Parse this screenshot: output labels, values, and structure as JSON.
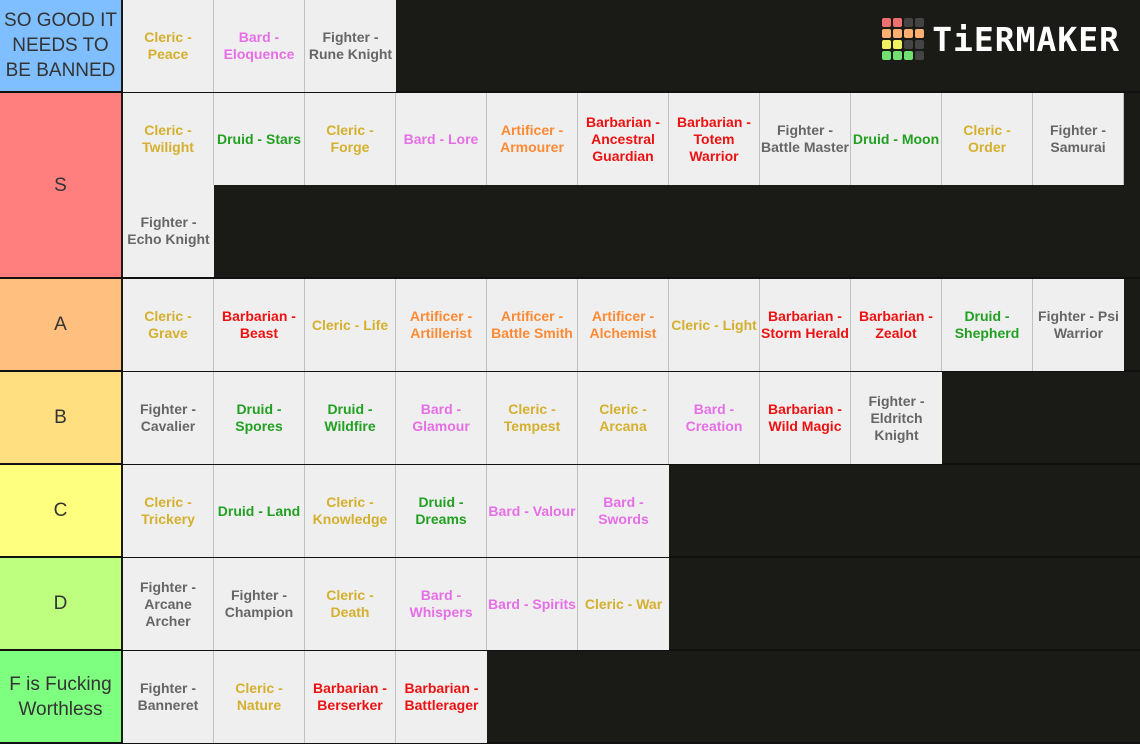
{
  "logo": {
    "text": "TiERMAKER",
    "grid_colors": [
      "#f07070",
      "#f07070",
      "#444444",
      "#444444",
      "#ffb070",
      "#ffb070",
      "#ffb070",
      "#ffb070",
      "#f0f060",
      "#f0f060",
      "#444444",
      "#444444",
      "#70e070",
      "#70e070",
      "#70e070",
      "#444444"
    ]
  },
  "class_colors": {
    "Cleric": "#d4b02e",
    "Bard": "#e66ee6",
    "Fighter": "#666666",
    "Druid": "#22a022",
    "Artificer": "#ff8a33",
    "Barbarian": "#ee1111"
  },
  "tiers": [
    {
      "label": "SO GOOD IT NEEDS TO BE BANNED",
      "color": "#80bfff",
      "items": [
        {
          "text": "Cleric - Peace",
          "cls": "Cleric"
        },
        {
          "text": "Bard - Eloquence",
          "cls": "Bard"
        },
        {
          "text": "Fighter - Rune Knight",
          "cls": "Fighter"
        }
      ]
    },
    {
      "label": "S",
      "color": "#ff7f7f",
      "items": [
        {
          "text": "Cleric - Twilight",
          "cls": "Cleric"
        },
        {
          "text": "Druid - Stars",
          "cls": "Druid"
        },
        {
          "text": "Cleric - Forge",
          "cls": "Cleric"
        },
        {
          "text": "Bard - Lore",
          "cls": "Bard"
        },
        {
          "text": "Artificer - Armourer",
          "cls": "Artificer"
        },
        {
          "text": "Barbarian - Ancestral Guardian",
          "cls": "Barbarian"
        },
        {
          "text": "Barbarian - Totem Warrior",
          "cls": "Barbarian"
        },
        {
          "text": "Fighter - Battle Master",
          "cls": "Fighter"
        },
        {
          "text": "Druid - Moon",
          "cls": "Druid"
        },
        {
          "text": "Cleric - Order",
          "cls": "Cleric"
        },
        {
          "text": "Fighter - Samurai",
          "cls": "Fighter"
        },
        {
          "text": "Fighter - Echo Knight",
          "cls": "Fighter"
        }
      ]
    },
    {
      "label": "A",
      "color": "#ffbf7f",
      "items": [
        {
          "text": "Cleric - Grave",
          "cls": "Cleric"
        },
        {
          "text": "Barbarian - Beast",
          "cls": "Barbarian"
        },
        {
          "text": "Cleric - Life",
          "cls": "Cleric"
        },
        {
          "text": "Artificer - Artillerist",
          "cls": "Artificer"
        },
        {
          "text": "Artificer - Battle Smith",
          "cls": "Artificer"
        },
        {
          "text": "Artificer - Alchemist",
          "cls": "Artificer"
        },
        {
          "text": "Cleric - Light",
          "cls": "Cleric"
        },
        {
          "text": "Barbarian - Storm Herald",
          "cls": "Barbarian"
        },
        {
          "text": "Barbarian - Zealot",
          "cls": "Barbarian"
        },
        {
          "text": "Druid - Shepherd",
          "cls": "Druid"
        },
        {
          "text": "Fighter - Psi Warrior",
          "cls": "Fighter"
        }
      ]
    },
    {
      "label": "B",
      "color": "#ffdf7f",
      "items": [
        {
          "text": "Fighter - Cavalier",
          "cls": "Fighter"
        },
        {
          "text": "Druid - Spores",
          "cls": "Druid"
        },
        {
          "text": "Druid - Wildfire",
          "cls": "Druid"
        },
        {
          "text": "Bard - Glamour",
          "cls": "Bard"
        },
        {
          "text": "Cleric - Tempest",
          "cls": "Cleric"
        },
        {
          "text": "Cleric - Arcana",
          "cls": "Cleric"
        },
        {
          "text": "Bard - Creation",
          "cls": "Bard"
        },
        {
          "text": "Barbarian - Wild Magic",
          "cls": "Barbarian"
        },
        {
          "text": "Fighter - Eldritch Knight",
          "cls": "Fighter"
        }
      ]
    },
    {
      "label": "C",
      "color": "#ffff7f",
      "items": [
        {
          "text": "Cleric - Trickery",
          "cls": "Cleric"
        },
        {
          "text": "Druid - Land",
          "cls": "Druid"
        },
        {
          "text": "Cleric - Knowledge",
          "cls": "Cleric"
        },
        {
          "text": "Druid - Dreams",
          "cls": "Druid"
        },
        {
          "text": "Bard - Valour",
          "cls": "Bard"
        },
        {
          "text": "Bard - Swords",
          "cls": "Bard"
        }
      ]
    },
    {
      "label": "D",
      "color": "#bfff7f",
      "items": [
        {
          "text": "Fighter - Arcane Archer",
          "cls": "Fighter"
        },
        {
          "text": "Fighter - Champion",
          "cls": "Fighter"
        },
        {
          "text": "Cleric - Death",
          "cls": "Cleric"
        },
        {
          "text": "Bard - Whispers",
          "cls": "Bard"
        },
        {
          "text": "Bard - Spirits",
          "cls": "Bard"
        },
        {
          "text": "Cleric - War",
          "cls": "Cleric"
        }
      ]
    },
    {
      "label": "F is Fucking Worthless",
      "color": "#7fff7f",
      "items": [
        {
          "text": "Fighter - Banneret",
          "cls": "Fighter"
        },
        {
          "text": "Cleric - Nature",
          "cls": "Cleric"
        },
        {
          "text": "Barbarian - Berserker",
          "cls": "Barbarian"
        },
        {
          "text": "Barbarian - Battlerager",
          "cls": "Barbarian"
        }
      ]
    }
  ]
}
